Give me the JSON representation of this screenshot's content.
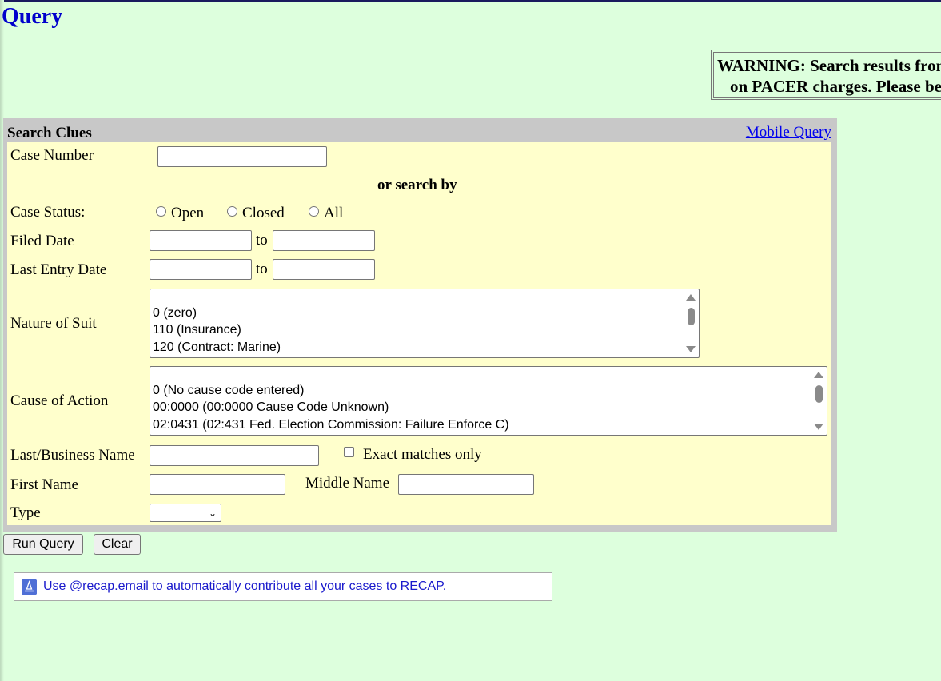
{
  "page": {
    "title": "Query"
  },
  "warning": {
    "line1": "WARNING: Search results from this query may result in PACER charges.",
    "line2": "on PACER charges. Please be as specific as possible."
  },
  "panel": {
    "header": "Search Clues",
    "mobile_link": "Mobile Query",
    "case_number_label": "Case Number",
    "or_search_by": "or search by",
    "case_status_label": "Case Status:",
    "status_options": [
      "Open",
      "Closed",
      "All"
    ],
    "filed_date_label": "Filed Date",
    "last_entry_date_label": "Last Entry Date",
    "to_label": "to",
    "nature_of_suit_label": "Nature of Suit",
    "nature_of_suit_options": [
      "0 (zero)",
      "110 (Insurance)",
      "120 (Contract: Marine)"
    ],
    "cause_of_action_label": "Cause of Action",
    "cause_of_action_options": [
      "0 (No cause code entered)",
      "00:0000 (00:0000 Cause Code Unknown)",
      "02:0431 (02:431 Fed. Election Commission: Failure Enforce C)"
    ],
    "last_name_label": "Last/Business Name",
    "exact_matches_label": "Exact matches only",
    "first_name_label": "First Name",
    "middle_name_label": "Middle Name",
    "type_label": "Type",
    "type_value": ""
  },
  "buttons": {
    "run_query": "Run Query",
    "clear": "Clear"
  },
  "recap": {
    "text": "Use @recap.email to automatically contribute all your cases to RECAP."
  }
}
